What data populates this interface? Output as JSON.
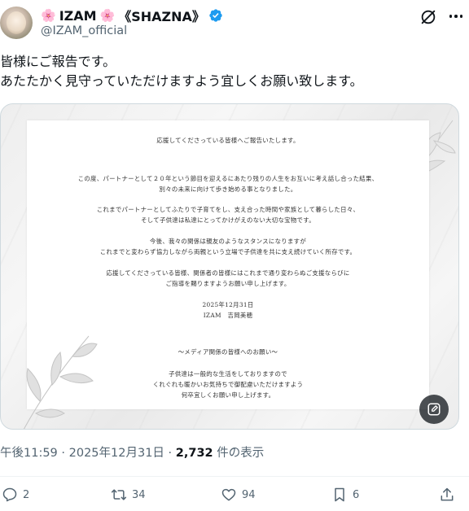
{
  "author": {
    "name_prefix": "🌸",
    "name_main": "IZAM",
    "name_mid": "🌸",
    "name_suffix": "《SHAZNA》",
    "handle": "@IZAM_official"
  },
  "tweet": {
    "line1": "皆様にご報告です。",
    "line2": "あたたかく見守っていただけますよう宜しくお願い致します。"
  },
  "document": {
    "p1": "応援してくださっている皆様へご報告いたします。",
    "p2a": "この度、パートナーとして２０年という節目を迎えるにあたり残りの人生をお互いに考え話し合った結果、",
    "p2b": "別々の未来に向けて歩き始める事となりました。",
    "p3a": "これまでパートナーとしてふたりで子育てをし、支え合った時間や家族として暮らした日々、",
    "p3b": "そして子供達は私達にとってかけがえのない大切な宝物です。",
    "p4a": "今後、我々の関係は親友のようなスタンスになりますが",
    "p4b": "これまでと変わらず協力しながら両親という立場で子供達を共に支え続けていく所存です。",
    "p5a": "応援してくださっている皆様、関係者の皆様にはこれまで通り変わらぬご支援ならびに",
    "p5b": "ご指導を賜りますようお願い申し上げます。",
    "date": "2025年12月31日",
    "signature": "IZAM　吉岡美穂",
    "media_heading": "～メディア関係の皆様へのお願い～",
    "m1": "子供達は一般的な生活をしておりますので",
    "m2": "くれぐれも暖かいお気持ちで御配慮いただけますよう",
    "m3": "何卒宜しくお願い申し上げます。"
  },
  "meta": {
    "time": "午後11:59",
    "sep1": "·",
    "date": "2025年12月31日",
    "sep2": "·",
    "views": "2,732",
    "views_label": "件の表示"
  },
  "actions": {
    "replies": "2",
    "reposts": "34",
    "likes": "94",
    "bookmarks": "6"
  },
  "colors": {
    "text": "#0f1419",
    "secondary": "#536471",
    "verified": "#1d9bf0",
    "sakura": "#f27aa6"
  },
  "icons": [
    "grok-icon",
    "more-icon",
    "verified-badge-icon",
    "edit-image-icon",
    "reply-icon",
    "repost-icon",
    "like-icon",
    "bookmark-icon",
    "share-icon"
  ]
}
